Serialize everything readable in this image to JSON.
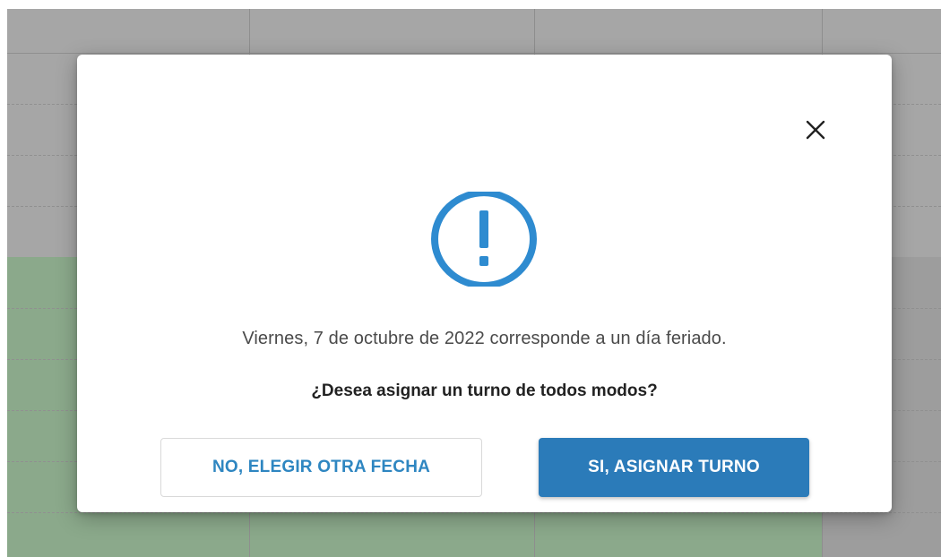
{
  "dialog": {
    "message": "Viernes, 7 de octubre de 2022 corresponde a un día feriado.",
    "question": "¿Desea asignar un turno de todos modos?",
    "cancel_label": "NO, ELEGIR OTRA FECHA",
    "confirm_label": "SI, ASIGNAR TURNO",
    "close_icon": "close-icon",
    "alert_icon": "exclamation-circle-icon"
  },
  "colors": {
    "accent": "#2b7bb9",
    "icon": "#2e8bd0",
    "overlay": "#a6a6a6",
    "event_green": "#8ba98b"
  }
}
